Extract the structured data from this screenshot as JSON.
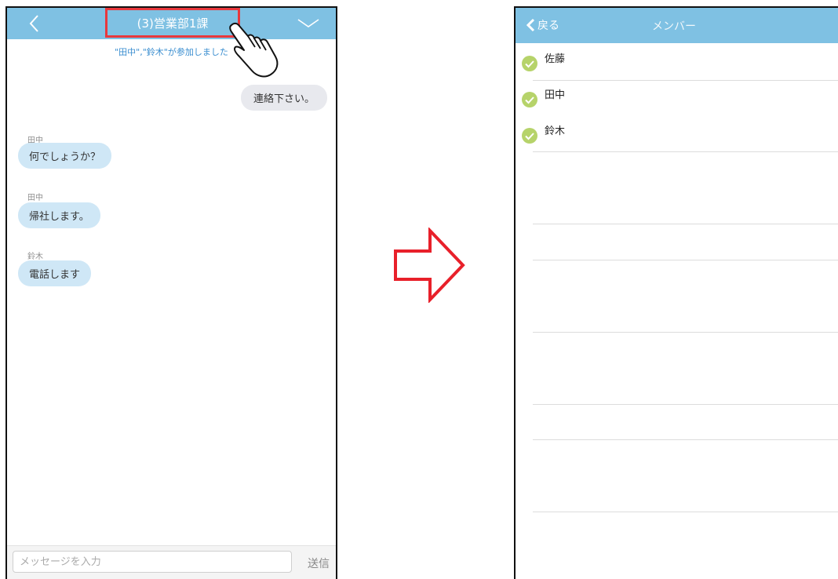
{
  "chat": {
    "title": "(3)営業部1課",
    "system_message": "\"田中\",\"鈴木\"が参加しました",
    "messages": [
      {
        "side": "right",
        "sender": "",
        "text": "連絡下さい。"
      },
      {
        "side": "left",
        "sender": "田中",
        "text": "何でしょうか？"
      },
      {
        "side": "left",
        "sender": "田中",
        "text": "帰社します。"
      },
      {
        "side": "left",
        "sender": "鈴木",
        "text": "電話します"
      }
    ],
    "input_placeholder": "メッセージを入力",
    "send_label": "送信"
  },
  "members_screen": {
    "back_label": "戻る",
    "title": "メンバー",
    "members": [
      {
        "name": "佐藤"
      },
      {
        "name": "田中"
      },
      {
        "name": "鈴木"
      }
    ]
  },
  "colors": {
    "header": "#7fc1e3",
    "highlight_box": "#e8383d",
    "system_text": "#3a8ed0",
    "incoming_bubble": "#cfe7f6",
    "outgoing_bubble": "#e8e9ee",
    "check": "#b6d36a",
    "arrow": "#e8202a"
  },
  "icons": {
    "chat_back": "chevron-left-icon",
    "chat_dropdown": "chevron-down-icon",
    "pointer": "pointing-hand-icon",
    "transition": "right-arrow-icon",
    "member_check": "check-circle-icon"
  }
}
